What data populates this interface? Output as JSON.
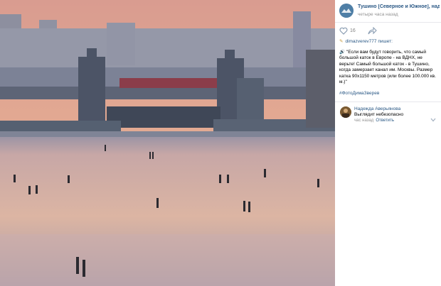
{
  "post": {
    "group_name": "Тушино [Северное и Южное], наде...",
    "time": "четыре часа назад",
    "likes": "16",
    "author_line": "dimazverev777 пишет:",
    "author_icon": "pencil-icon",
    "quote": "🔊 \"Если вам будут говорить, что самый большой каток в Европе - на ВДНХ, не верьте! Самый большой каток - в Тушино, когда замерзает канал им. Москвы. Размер катка 90х1150 метров (или более 100.000 кв. м.)\"",
    "hashtag": "#ФотоДимаЗверев"
  },
  "comment": {
    "author": "Надежда Аверьянова",
    "text": "Выглядит небезопасно",
    "meta": "час назад",
    "reply": "Ответить"
  },
  "colors": {
    "link": "#2a5885",
    "muted": "#939393",
    "sky": "#e0a38d",
    "ice": "#d6b4a6"
  }
}
